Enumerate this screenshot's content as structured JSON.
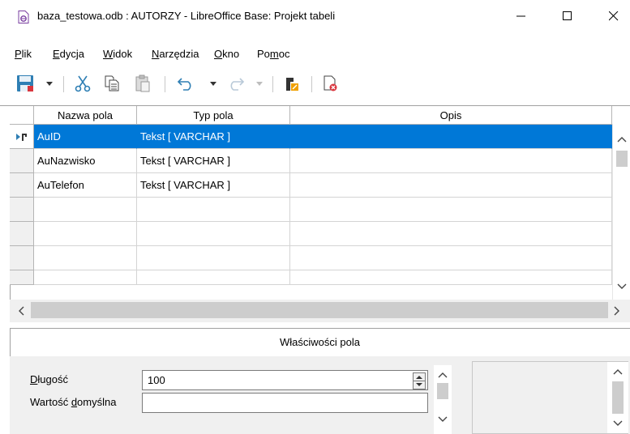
{
  "window": {
    "title": "baza_testowa.odb : AUTORZY - LibreOffice Base: Projekt tabeli",
    "controls": [
      "minimize",
      "maximize",
      "close"
    ]
  },
  "menu": {
    "items": [
      {
        "label": "Plik",
        "accel": "P"
      },
      {
        "label": "Edycja",
        "accel": "E"
      },
      {
        "label": "Widok",
        "accel": "W"
      },
      {
        "label": "Narzędzia",
        "accel": "N"
      },
      {
        "label": "Okno",
        "accel": "O"
      },
      {
        "label": "Pomoc",
        "accel": "m"
      }
    ]
  },
  "toolbar": {
    "icons": [
      "save-icon",
      "dropdown-arrow-icon",
      "cut-icon",
      "copy-icon",
      "paste-icon",
      "undo-icon",
      "redo-icon",
      "primary-key-icon",
      "index-design-icon"
    ]
  },
  "grid": {
    "columns": [
      "Nazwa pola",
      "Typ pola",
      "Opis"
    ],
    "rows": [
      {
        "name": "AuID",
        "type": "Tekst [ VARCHAR ]",
        "desc": "",
        "primary_key": true
      },
      {
        "name": "AuNazwisko",
        "type": "Tekst [ VARCHAR ]",
        "desc": ""
      },
      {
        "name": "AuTelefon",
        "type": "Tekst [ VARCHAR ]",
        "desc": ""
      },
      {
        "name": "",
        "type": "",
        "desc": ""
      },
      {
        "name": "",
        "type": "",
        "desc": ""
      },
      {
        "name": "",
        "type": "",
        "desc": ""
      },
      {
        "name": "",
        "type": "",
        "desc": ""
      }
    ],
    "selected_row": 0,
    "selection_color": "#0078d7"
  },
  "properties": {
    "title": "Właściwości pola",
    "fields": [
      {
        "label_pre": "",
        "label_accel": "D",
        "label_post": "ługość",
        "value": "100"
      },
      {
        "label_pre": "Wartość ",
        "label_accel": "d",
        "label_post": "omyślna",
        "value": ""
      }
    ]
  }
}
